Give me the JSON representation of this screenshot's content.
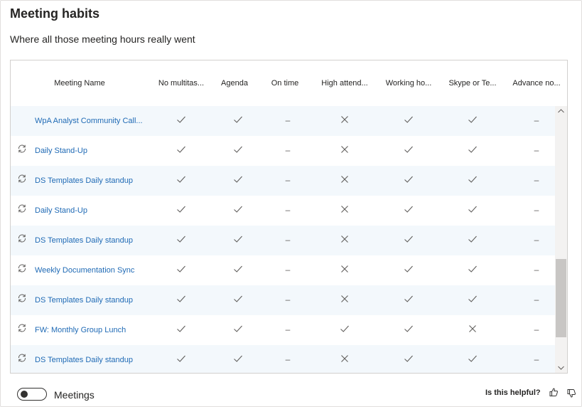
{
  "card": {
    "title": "Meeting habits",
    "subtitle": "Where all those meeting hours really went"
  },
  "table": {
    "columns": [
      "Meeting Name",
      "No multitas...",
      "Agenda",
      "On time",
      "High attend...",
      "Working ho...",
      "Skype or Te...",
      "Advance no..."
    ],
    "rows": [
      {
        "name": "WpA Analyst Community Call...",
        "recurring": false,
        "values": [
          "check",
          "check",
          "dash",
          "cross",
          "check",
          "check",
          "dash"
        ]
      },
      {
        "name": "Daily Stand-Up",
        "recurring": true,
        "values": [
          "check",
          "check",
          "dash",
          "cross",
          "check",
          "check",
          "dash"
        ]
      },
      {
        "name": "DS Templates Daily standup",
        "recurring": true,
        "values": [
          "check",
          "check",
          "dash",
          "cross",
          "check",
          "check",
          "dash"
        ]
      },
      {
        "name": "Daily Stand-Up",
        "recurring": true,
        "values": [
          "check",
          "check",
          "dash",
          "cross",
          "check",
          "check",
          "dash"
        ]
      },
      {
        "name": "DS Templates Daily standup",
        "recurring": true,
        "values": [
          "check",
          "check",
          "dash",
          "cross",
          "check",
          "check",
          "dash"
        ]
      },
      {
        "name": "Weekly Documentation Sync",
        "recurring": true,
        "values": [
          "check",
          "check",
          "dash",
          "cross",
          "check",
          "check",
          "dash"
        ]
      },
      {
        "name": "DS Templates Daily standup",
        "recurring": true,
        "values": [
          "check",
          "check",
          "dash",
          "cross",
          "check",
          "check",
          "dash"
        ]
      },
      {
        "name": "FW: Monthly Group Lunch",
        "recurring": true,
        "values": [
          "check",
          "check",
          "dash",
          "check",
          "check",
          "cross",
          "dash"
        ]
      },
      {
        "name": "DS Templates Daily standup",
        "recurring": true,
        "values": [
          "check",
          "check",
          "dash",
          "cross",
          "check",
          "check",
          "dash"
        ]
      }
    ]
  },
  "footer": {
    "toggle_label": "Meetings",
    "toggle_on": false,
    "helpful_label": "Is this helpful?"
  },
  "colors": {
    "link": "#1f6ab5",
    "alt_row": "#f3f8fc",
    "icon": "#605e5c"
  },
  "icons": [
    "recurring-icon",
    "check-icon",
    "cross-icon",
    "thumbs-up-icon",
    "thumbs-down-icon",
    "scroll-up-icon",
    "scroll-down-icon"
  ]
}
